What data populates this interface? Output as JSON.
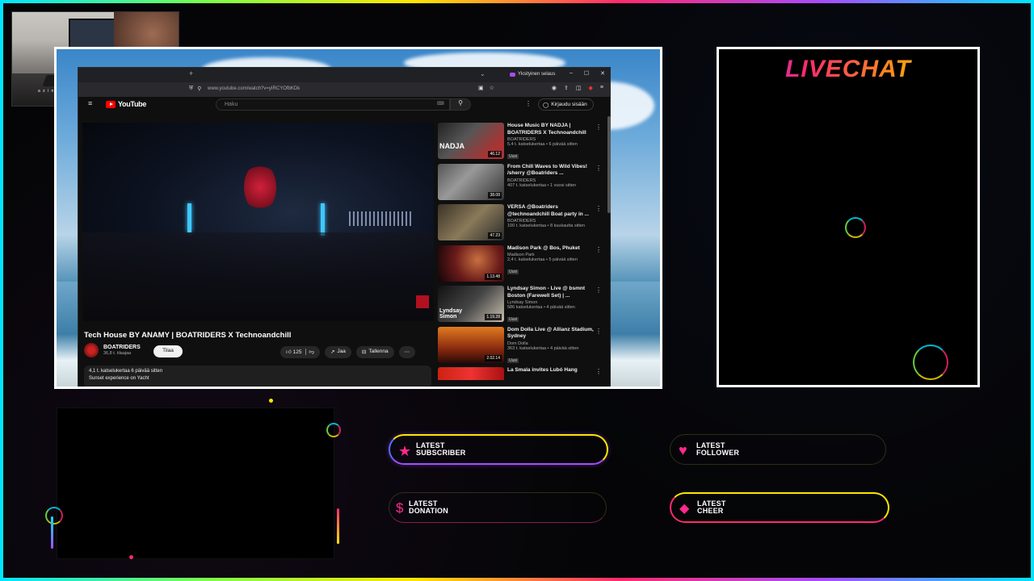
{
  "colors": {
    "accent_pink": "#ff2a8a",
    "accent_yellow": "#ffe600",
    "accent_purple": "#a64dff",
    "accent_cyan": "#00e5ff"
  },
  "webcam": {
    "caption": "a z i n g   c r u i s e"
  },
  "browser": {
    "private_label": "Yksityinen selaus",
    "url": "www.youtube.com/watch?v=yIRCYOfbKDk",
    "controls": [
      "–",
      "☐",
      "✕"
    ]
  },
  "youtube": {
    "logo": "YouTube",
    "search_placeholder": "Haku",
    "signin": "Kirjaudu sisään",
    "video": {
      "title": "Tech House BY ANAMY | BOATRIDERS X Technoandchill",
      "channel": "BOATRIDERS",
      "subscribers": "36,8 t. tilaajaa",
      "subscribe": "Tilaa",
      "likes": "125",
      "share": "Jaa",
      "save": "Tallenna",
      "views_date": "4,1 t. katselukertaa  6 päivää sitten",
      "description": "Sunset experience on Yacht"
    },
    "recommendations": [
      {
        "title": "House Music BY NADJA | BOATRIDERS X Technoandchill",
        "channel": "BOATRIDERS",
        "meta": "5,4 t. katselukertaa • 6 päivää sitten",
        "badge": "Uusi",
        "duration": "46.12",
        "thumb_text": "NADJA"
      },
      {
        "title": "From Chill Waves to Wild Vibes! /sherry @Boatriders ...",
        "channel": "BOATRIDERS",
        "meta": "407 t. katselukertaa • 1 vuosi sitten",
        "badge": "",
        "duration": "38.08",
        "thumb_text": ""
      },
      {
        "title": "VERSA @Boatriders @technoandchill Boat party in ...",
        "channel": "BOATRIDERS",
        "meta": "100 t. katselukertaa • 8 kuukautta sitten",
        "badge": "",
        "duration": "47.23",
        "thumb_text": ""
      },
      {
        "title": "Madison Park @ Bos, Phuket",
        "channel": "Madison Park",
        "meta": "2,4 t. katselukertaa • 5 päivää sitten",
        "badge": "Uusi",
        "duration": "1.13.48",
        "thumb_text": ""
      },
      {
        "title": "Lyndsay Simon - Live @ bsmnt Boston (Farewell Set) | ...",
        "channel": "Lyndsay Simon",
        "meta": "586 katselukertaa • 4 päivää sitten",
        "badge": "Uusi",
        "duration": "1.19.28",
        "thumb_text": "Lyndsay Simon"
      },
      {
        "title": "Dom Dolla Live @ Allianz Stadium, Sydney",
        "channel": "Dom Dolla",
        "meta": "363 t. katselukertaa • 4 päivää sitten",
        "badge": "Uusi",
        "duration": "2.02.14",
        "thumb_text": ""
      },
      {
        "title": "La Smala invites Lubó Hang",
        "channel": "",
        "meta": "",
        "badge": "",
        "duration": "",
        "thumb_text": ""
      }
    ]
  },
  "livechat": {
    "title": "LIVECHAT"
  },
  "alerts": {
    "subscriber": "LATEST\nSUBSCRIBER",
    "follower": "LATEST\nFOLLOWER",
    "donation": "LATEST\nDONATION",
    "cheer": "LATEST\nCHEER"
  }
}
